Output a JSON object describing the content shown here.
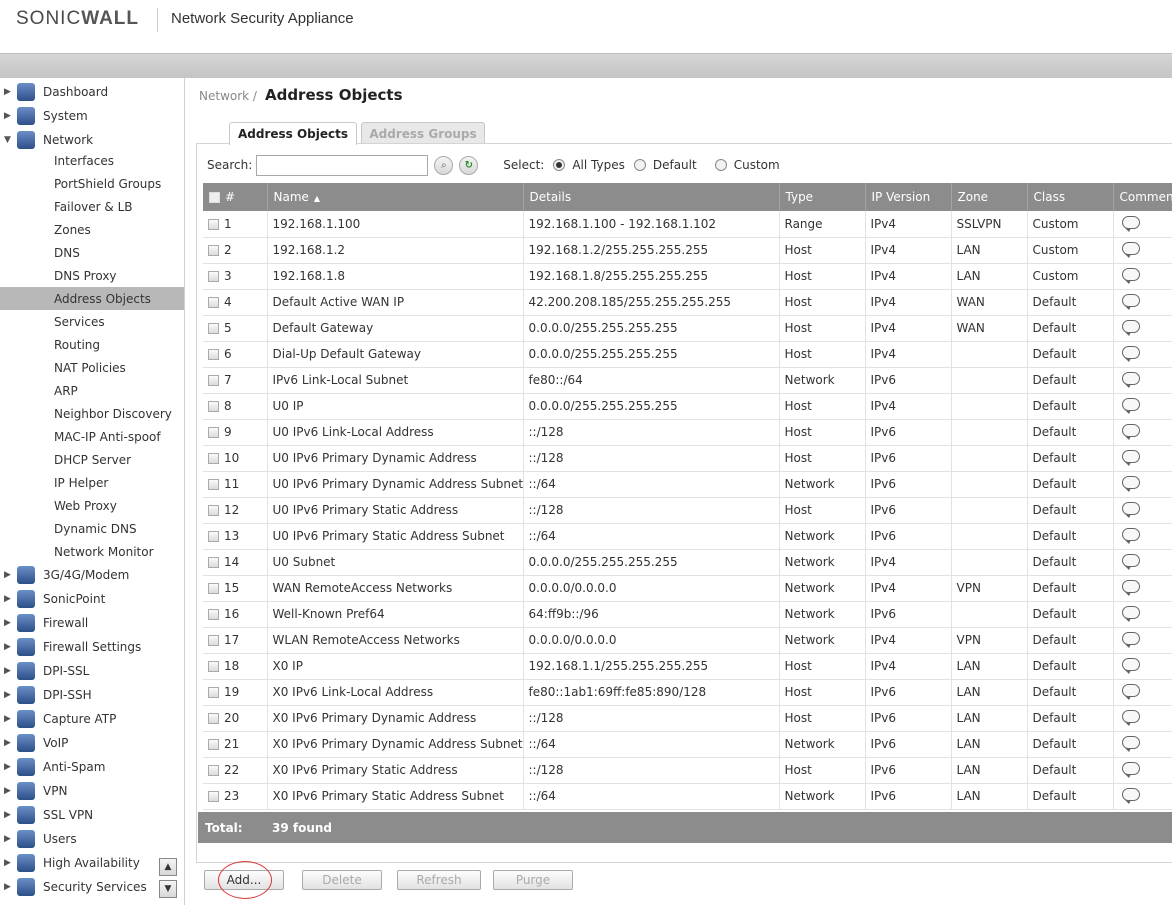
{
  "header": {
    "logo_a": "SONIC",
    "logo_b": "WALL",
    "app_title": "Network Security Appliance"
  },
  "sidebar": {
    "top_items": [
      {
        "label": "Dashboard",
        "arrow": "▶"
      },
      {
        "label": "System",
        "arrow": "▶"
      },
      {
        "label": "Network",
        "arrow": "▼"
      }
    ],
    "sub_items": [
      "Interfaces",
      "PortShield Groups",
      "Failover & LB",
      "Zones",
      "DNS",
      "DNS Proxy",
      "Address Objects",
      "Services",
      "Routing",
      "NAT Policies",
      "ARP",
      "Neighbor Discovery",
      "MAC-IP Anti-spoof",
      "DHCP Server",
      "IP Helper",
      "Web Proxy",
      "Dynamic DNS",
      "Network Monitor"
    ],
    "bottom_items": [
      "3G/4G/Modem",
      "SonicPoint",
      "Firewall",
      "Firewall Settings",
      "DPI-SSL",
      "DPI-SSH",
      "Capture ATP",
      "VoIP",
      "Anti-Spam",
      "VPN",
      "SSL VPN",
      "Users",
      "High Availability",
      "Security Services"
    ],
    "arrow_right": "▶",
    "scroll_up": "▲",
    "scroll_down": "▼"
  },
  "breadcrumb": {
    "parent": "Network /",
    "title": "Address Objects"
  },
  "tabs": [
    "Address Objects",
    "Address Groups"
  ],
  "search": {
    "label": "Search:",
    "value": "",
    "select_label": "Select:",
    "options": [
      "All Types",
      "Default",
      "Custom"
    ],
    "selected": "All Types"
  },
  "table": {
    "columns": [
      "#",
      "Name",
      "Details",
      "Type",
      "IP Version",
      "Zone",
      "Class",
      "Comment"
    ],
    "rows": [
      [
        "1",
        "192.168.1.100",
        "192.168.1.100 - 192.168.1.102",
        "Range",
        "IPv4",
        "SSLVPN",
        "Custom"
      ],
      [
        "2",
        "192.168.1.2",
        "192.168.1.2/255.255.255.255",
        "Host",
        "IPv4",
        "LAN",
        "Custom"
      ],
      [
        "3",
        "192.168.1.8",
        "192.168.1.8/255.255.255.255",
        "Host",
        "IPv4",
        "LAN",
        "Custom"
      ],
      [
        "4",
        "Default Active WAN IP",
        "42.200.208.185/255.255.255.255",
        "Host",
        "IPv4",
        "WAN",
        "Default"
      ],
      [
        "5",
        "Default Gateway",
        "0.0.0.0/255.255.255.255",
        "Host",
        "IPv4",
        "WAN",
        "Default"
      ],
      [
        "6",
        "Dial-Up Default Gateway",
        "0.0.0.0/255.255.255.255",
        "Host",
        "IPv4",
        "",
        "Default"
      ],
      [
        "7",
        "IPv6 Link-Local Subnet",
        "fe80::/64",
        "Network",
        "IPv6",
        "",
        "Default"
      ],
      [
        "8",
        "U0 IP",
        "0.0.0.0/255.255.255.255",
        "Host",
        "IPv4",
        "",
        "Default"
      ],
      [
        "9",
        "U0 IPv6 Link-Local Address",
        "::/128",
        "Host",
        "IPv6",
        "",
        "Default"
      ],
      [
        "10",
        "U0 IPv6 Primary Dynamic Address",
        "::/128",
        "Host",
        "IPv6",
        "",
        "Default"
      ],
      [
        "11",
        "U0 IPv6 Primary Dynamic Address Subnet",
        "::/64",
        "Network",
        "IPv6",
        "",
        "Default"
      ],
      [
        "12",
        "U0 IPv6 Primary Static Address",
        "::/128",
        "Host",
        "IPv6",
        "",
        "Default"
      ],
      [
        "13",
        "U0 IPv6 Primary Static Address Subnet",
        "::/64",
        "Network",
        "IPv6",
        "",
        "Default"
      ],
      [
        "14",
        "U0 Subnet",
        "0.0.0.0/255.255.255.255",
        "Network",
        "IPv4",
        "",
        "Default"
      ],
      [
        "15",
        "WAN RemoteAccess Networks",
        "0.0.0.0/0.0.0.0",
        "Network",
        "IPv4",
        "VPN",
        "Default"
      ],
      [
        "16",
        "Well-Known Pref64",
        "64:ff9b::/96",
        "Network",
        "IPv6",
        "",
        "Default"
      ],
      [
        "17",
        "WLAN RemoteAccess Networks",
        "0.0.0.0/0.0.0.0",
        "Network",
        "IPv4",
        "VPN",
        "Default"
      ],
      [
        "18",
        "X0 IP",
        "192.168.1.1/255.255.255.255",
        "Host",
        "IPv4",
        "LAN",
        "Default"
      ],
      [
        "19",
        "X0 IPv6 Link-Local Address",
        "fe80::1ab1:69ff:fe85:890/128",
        "Host",
        "IPv6",
        "LAN",
        "Default"
      ],
      [
        "20",
        "X0 IPv6 Primary Dynamic Address",
        "::/128",
        "Host",
        "IPv6",
        "LAN",
        "Default"
      ],
      [
        "21",
        "X0 IPv6 Primary Dynamic Address Subnet",
        "::/64",
        "Network",
        "IPv6",
        "LAN",
        "Default"
      ],
      [
        "22",
        "X0 IPv6 Primary Static Address",
        "::/128",
        "Host",
        "IPv6",
        "LAN",
        "Default"
      ],
      [
        "23",
        "X0 IPv6 Primary Static Address Subnet",
        "::/64",
        "Network",
        "IPv6",
        "LAN",
        "Default"
      ]
    ]
  },
  "total": {
    "label": "Total:",
    "value": "39 found"
  },
  "actions": {
    "add": "Add...",
    "delete": "Delete",
    "refresh": "Refresh",
    "purge": "Purge"
  },
  "icons": {
    "sort_asc": "▲",
    "search_btn": "⌕",
    "refresh_btn": "↻"
  },
  "colors": {
    "header_grid": "#8c8c8c",
    "active_nav": "#b8b8b8",
    "highlight_circle": "#dd3333"
  }
}
